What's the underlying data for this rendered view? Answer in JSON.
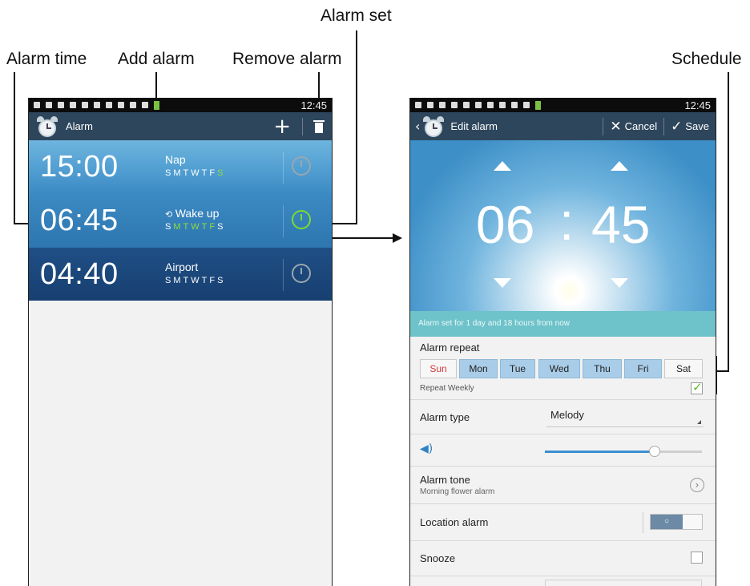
{
  "callouts": {
    "alarm_set": "Alarm set",
    "alarm_time": "Alarm time",
    "add_alarm": "Add alarm",
    "remove_alarm": "Remove alarm",
    "schedule": "Schedule"
  },
  "status_bar": {
    "time": "12:45"
  },
  "list_screen": {
    "title": "Alarm",
    "add_icon": "plus-icon",
    "delete_icon": "trash-icon",
    "alarms": [
      {
        "time": "15:00",
        "name": "Nap",
        "days": [
          "S",
          "M",
          "T",
          "W",
          "T",
          "F",
          "S"
        ],
        "active_days": [
          6
        ],
        "enabled": false
      },
      {
        "time": "06:45",
        "name": "Wake up",
        "repeat_icon": "repeat-icon",
        "days": [
          "S",
          "M",
          "T",
          "W",
          "T",
          "F",
          "S"
        ],
        "active_days": [
          1,
          2,
          3,
          4,
          5
        ],
        "enabled": true
      },
      {
        "time": "04:40",
        "name": "Airport",
        "days": [
          "S",
          "M",
          "T",
          "W",
          "T",
          "F",
          "S"
        ],
        "active_days": [],
        "enabled": false
      }
    ]
  },
  "edit_screen": {
    "title": "Edit alarm",
    "cancel_label": "Cancel",
    "save_label": "Save",
    "hour": "06",
    "separator": ":",
    "minute": "45",
    "alarm_set_text": "Alarm set for 1 day and 18 hours from now",
    "repeat_label": "Alarm repeat",
    "days": [
      "Sun",
      "Mon",
      "Tue",
      "Wed",
      "Thu",
      "Fri",
      "Sat"
    ],
    "selected_days": [
      1,
      2,
      3,
      4,
      5
    ],
    "repeat_weekly_label": "Repeat Weekly",
    "repeat_weekly": true,
    "alarm_type_label": "Alarm type",
    "alarm_type_value": "Melody",
    "volume_level": 0.7,
    "alarm_tone_label": "Alarm tone",
    "alarm_tone_value": "Morning flower alarm",
    "location_alarm_label": "Location alarm",
    "location_alarm_on": false,
    "snooze_label": "Snooze",
    "snooze_on": false
  },
  "colors": {
    "header_bar": "#2e465c",
    "active_day": "#8fdc3c",
    "selected_day_button": "#a9cde8",
    "sunday_text": "#d43a3a",
    "strip": "#6ec2c9"
  }
}
